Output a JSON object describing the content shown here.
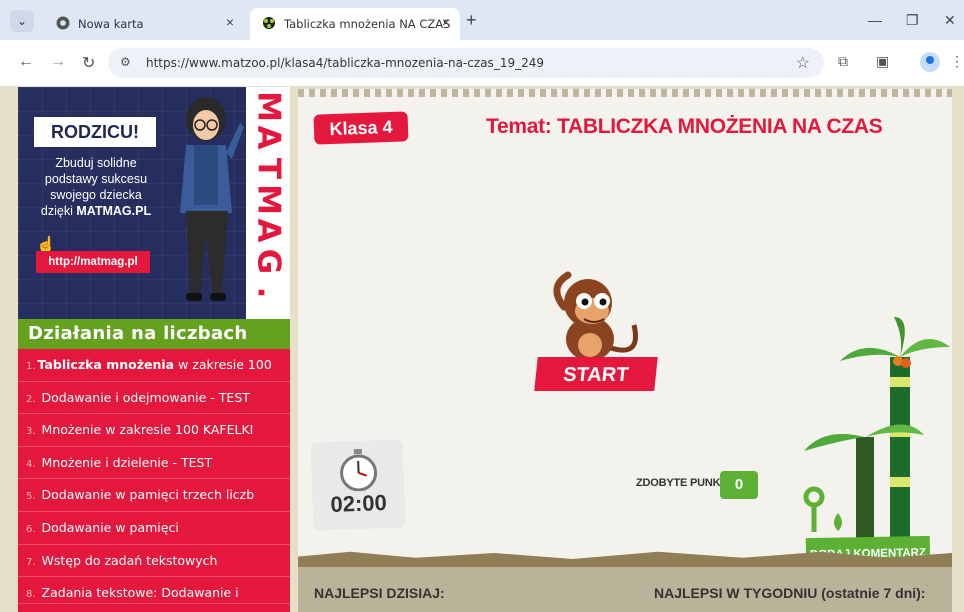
{
  "browser": {
    "tabs": [
      {
        "title": "Nowa karta",
        "active": false
      },
      {
        "title": "Tabliczka mnożenia NA CZAS",
        "active": true
      }
    ],
    "url": "https://www.matzoo.pl/klasa4/tabliczka-mnozenia-na-czas_19_249"
  },
  "banner": {
    "heading": "RODZICU!",
    "line1": "Zbuduj solidne",
    "line2": "podstawy sukcesu",
    "line3": "swojego dziecka",
    "line4_prefix": "dzięki ",
    "line4_brand": "MATMAG.PL",
    "link": "http://matmag.pl",
    "brand_vertical": [
      "M",
      "A",
      "T",
      "M",
      "A",
      "G",
      "."
    ]
  },
  "sidebar": {
    "heading": "Działania na liczbach",
    "items": [
      {
        "num": "1.",
        "bold": "Tabliczka mnożenia",
        "rest": " w zakresie 100"
      },
      {
        "num": "2.",
        "bold": "",
        "rest": "Dodawanie i odejmowanie - TEST"
      },
      {
        "num": "3.",
        "bold": "",
        "rest": "Mnożenie w zakresie 100 KAFELKI"
      },
      {
        "num": "4.",
        "bold": "",
        "rest": "Mnożenie i dzielenie - TEST"
      },
      {
        "num": "5.",
        "bold": "",
        "rest": "Dodawanie w pamięci trzech liczb"
      },
      {
        "num": "6.",
        "bold": "",
        "rest": "Dodawanie w pamięci"
      },
      {
        "num": "7.",
        "bold": "",
        "rest": "Wstęp do zadań tekstowych"
      },
      {
        "num": "8.",
        "bold": "",
        "rest": "Zadania tekstowe: Dodawanie i"
      }
    ]
  },
  "game": {
    "grade": "Klasa 4",
    "topic": "Temat: TABLICZKA MNOŻENIA NA CZAS",
    "start": "START",
    "timer": "02:00",
    "points_label": "ZDOBYTE PUNKTY:",
    "points": "0",
    "comment_button": "DODAJ KOMENTARZ"
  },
  "lower": {
    "left": "NAJLEPSI DZISIAJ:",
    "right": "NAJLEPSI W TYGODNIU (ostatnie 7 dni):"
  },
  "colors": {
    "red": "#e3183c",
    "green": "#5cb135",
    "navy": "#252e5e"
  }
}
